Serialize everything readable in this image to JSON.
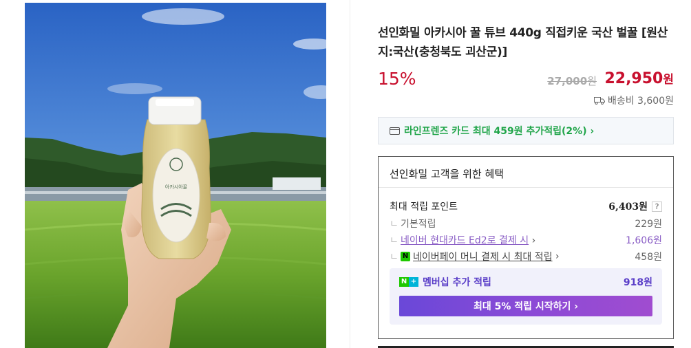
{
  "product": {
    "title": "선인화밀 아카시아 꿀 튜브 440g 직접키운 국산 벌꿀 [원산지:국산(충청북도 괴산군)]",
    "discount": "15%",
    "original_price": "27,000",
    "original_price_unit": "원",
    "sale_price": "22,950",
    "sale_price_unit": "원",
    "shipping": "배송비 3,600원"
  },
  "card_promo": {
    "label": "라인프렌즈 카드 최대 459원 추가적립(2%) ›"
  },
  "benefits": {
    "title": "선인화밀 고객을 위한 혜택",
    "max_points_label": "최대 적립 포인트",
    "max_points_value": "6,403원",
    "help_label": "?",
    "basic_label": "기본적립",
    "basic_value": "229원",
    "card_label": "네이버 현대카드 Ed2로 결제 시",
    "card_value": "1,606원",
    "npay_icon_label": "N",
    "npay_label": "네이버페이 머니 결제 시 최대 적립",
    "npay_value": "458원",
    "chevron": "›",
    "branch": "ㄴ"
  },
  "membership": {
    "n_icon": "N",
    "plus_icon": "+",
    "label": "멤버십 추가 적립",
    "value": "918원",
    "button_label": "최대 5% 적립 시작하기 ›"
  },
  "bottle": {
    "label_text": "아카시아꿀"
  },
  "colors": {
    "accent_red": "#c8102e",
    "naver_green": "#21a54a",
    "membership_purple": "#5a3ec8"
  },
  "icons": [
    "truck-icon",
    "card-icon",
    "help-icon",
    "npay-icon",
    "nplus-icon",
    "chevron-right-icon"
  ]
}
